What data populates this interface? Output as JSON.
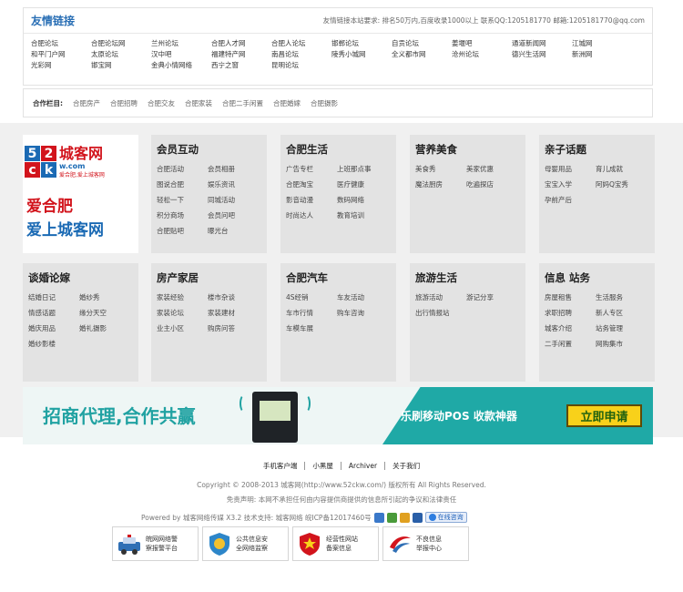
{
  "friend_links": {
    "title": "友情链接",
    "note": "友情链接本站要求: 排名50万内,百度收录1000以上 联系QQ:1205181770 邮箱:1205181770@qq.com",
    "links": [
      "合肥论坛",
      "合肥论坛网",
      "兰州论坛",
      "合肥人才网",
      "合肥人论坛",
      "邯郸论坛",
      "自贡论坛",
      "姜堰吧",
      "通道新闻网",
      "江城网",
      "和平门户网",
      "太原论坛",
      "汉中吧",
      "福建特产网",
      "南昌论坛",
      "陵秀小城网",
      "全义都市网",
      "沧州论坛",
      "德兴生活网",
      "新洲网",
      "光彩网",
      "邯宝网",
      "金典小情网络",
      "西宁之窗",
      "昆明论坛"
    ]
  },
  "partners": {
    "label": "合作栏目:",
    "items": [
      "合肥房产",
      "合肥招聘",
      "合肥交友",
      "合肥家装",
      "合肥二手闲置",
      "合肥婚嫁",
      "合肥摄影"
    ]
  },
  "logo": {
    "squares": [
      "5",
      "2",
      "c",
      "k"
    ],
    "name": "城客网",
    "domain": "w.com",
    "tagline": "爱合肥,爱上城客网",
    "slogan1": "爱合肥",
    "slogan2": "爱上城客网"
  },
  "categories": [
    {
      "title": "会员互动",
      "items": [
        "合肥活动",
        "会员相册",
        "图说合肥",
        "娱乐资讯",
        "轻松一下",
        "同城活动",
        "积分商场",
        "会员问吧",
        "合肥贴吧",
        "曝光台"
      ]
    },
    {
      "title": "合肥生活",
      "items": [
        "广告专栏",
        "上班那点事",
        "合肥淘宝",
        "医疗健康",
        "影音动漫",
        "数码网络",
        "时尚达人",
        "教育培训"
      ]
    },
    {
      "title": "营养美食",
      "items": [
        "美食秀",
        "美家优惠",
        "魔法厨房",
        "吃遍探店"
      ]
    },
    {
      "title": "亲子话题",
      "items": [
        "母婴用品",
        "育儿成就",
        "宝宝入学",
        "阿妈Q宝秀",
        "孕前产后"
      ]
    },
    {
      "title": "谈婚论嫁",
      "items": [
        "结婚日记",
        "婚纱秀",
        "情感话题",
        "缘分天空",
        "婚庆用品",
        "婚礼摄影",
        "婚纱影楼"
      ]
    },
    {
      "title": "房产家居",
      "items": [
        "家装经验",
        "楼市杂谈",
        "家装论坛",
        "家装建材",
        "业主小区",
        "购房问答"
      ]
    },
    {
      "title": "合肥汽车",
      "items": [
        "4S经销",
        "车友活动",
        "车市行情",
        "购车咨询",
        "车模车展"
      ]
    },
    {
      "title": "旅游生活",
      "items": [
        "旅游活动",
        "游记分享",
        "出行情报站"
      ]
    },
    {
      "title": "信息 站务",
      "items": [
        "房屋租售",
        "生活服务",
        "求职招聘",
        "新人专区",
        "城客介绍",
        "站务管理",
        "二手闲置",
        "网购集市"
      ]
    }
  ],
  "banner": {
    "left_text": "招商代理,合作共赢",
    "pos_text": "乐刷移动POS  收款神器",
    "button_label": "立即申请"
  },
  "footer": {
    "nav": [
      "手机客户端",
      "小黑屋",
      "Archiver",
      "关于我们"
    ],
    "copyright": "Copyright © 2008-2013 城客网(http://www.52ckw.com/) 版权所有 All Rights Reserved.",
    "disclaimer": "免责声明: 本网不承担任何由内容提供商提供的信息所引起的争议和法律责任",
    "powered": "Powered by 城客网络传媒 X3.2  技术支持: 城客网络 皖ICP备12017460号",
    "online_label": "在线咨询",
    "badges": [
      {
        "line1": "皖网网络警",
        "line2": "察报警平台"
      },
      {
        "line1": "公共信息安",
        "line2": "全网络监察"
      },
      {
        "line1": "经营性网站",
        "line2": "备案信息"
      },
      {
        "line1": "不良信息",
        "line2": "举报中心"
      }
    ]
  },
  "colors": {
    "link_blue": "#2a6fb5",
    "red": "#d2141c",
    "teal": "#1fa9a6",
    "yellow": "#f8d11a",
    "gray_cell": "#e3e3e3"
  }
}
